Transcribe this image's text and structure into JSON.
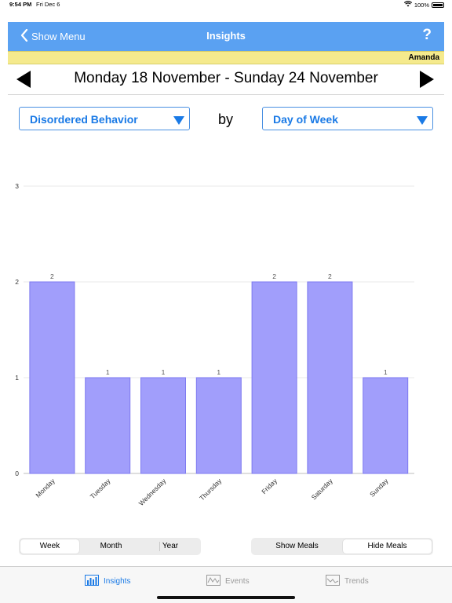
{
  "status_bar": {
    "time": "9:54 PM",
    "date": "Fri Dec 6",
    "battery": "100%"
  },
  "nav": {
    "back_label": "Show Menu",
    "title": "Insights",
    "help": "?"
  },
  "user": {
    "name": "Amanda"
  },
  "week": {
    "range": "Monday 18 November - Sunday 24 November"
  },
  "selectors": {
    "category": "Disordered Behavior",
    "by_label": "by",
    "grouping": "Day of Week"
  },
  "colors": {
    "accent": "#5aa1f2",
    "bar_fill": "#a19efb",
    "bar_stroke": "#7d79f0",
    "banner": "#f5ea8d"
  },
  "chart_data": {
    "type": "bar",
    "categories": [
      "Monday",
      "Tuesday",
      "Wednesday",
      "Thursday",
      "Friday",
      "Saturday",
      "Sunday"
    ],
    "values": [
      2,
      1,
      1,
      1,
      2,
      2,
      1
    ],
    "yticks": [
      "0",
      "1",
      "2",
      "3"
    ],
    "ylim": [
      0,
      3
    ],
    "grid": true,
    "data_labels": true
  },
  "period_control": {
    "options": [
      "Week",
      "Month",
      "Year"
    ],
    "selected": "Week"
  },
  "meals_control": {
    "options": [
      "Show Meals",
      "Hide Meals"
    ],
    "selected": "Hide Meals"
  },
  "tabs": [
    {
      "label": "Insights",
      "icon": "bar-chart-icon",
      "active": true
    },
    {
      "label": "Events",
      "icon": "events-chart-icon",
      "active": false
    },
    {
      "label": "Trends",
      "icon": "trends-chart-icon",
      "active": false
    }
  ]
}
